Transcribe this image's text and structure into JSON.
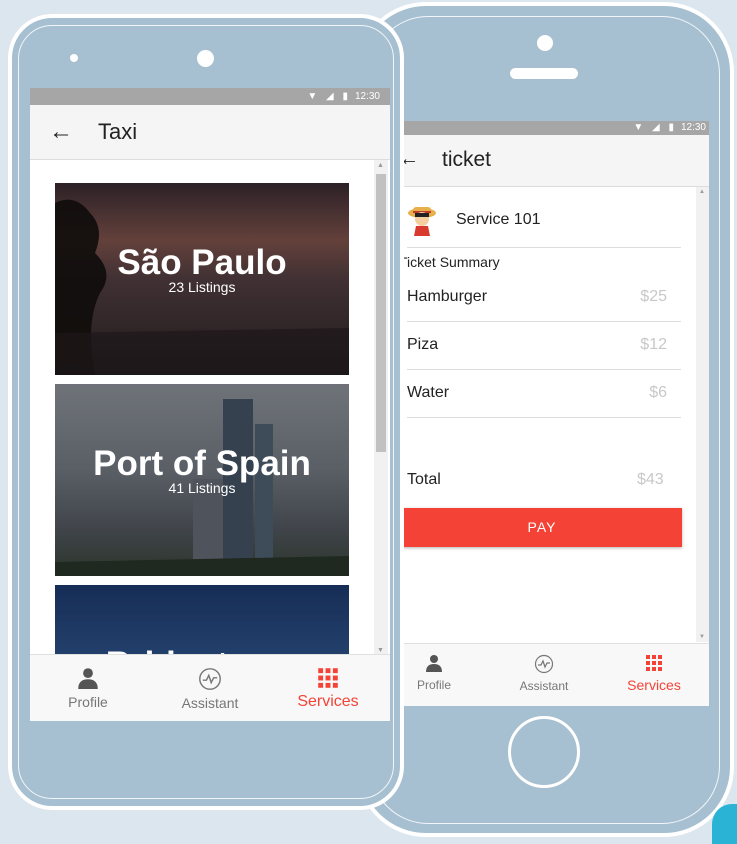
{
  "status_bar": {
    "icons": "▼ ◢ ▮",
    "time": "12:30"
  },
  "left_screen": {
    "title": "Taxi",
    "cards": [
      {
        "city": "São Paulo",
        "listings": "23 Listings"
      },
      {
        "city": "Port of Spain",
        "listings": "41 Listings"
      },
      {
        "city": "Bridgetown",
        "listings": ""
      }
    ]
  },
  "right_screen": {
    "title": "ticket",
    "service_name": "Service 101",
    "summary_label": "Ticket Summary",
    "items": [
      {
        "name": "Hamburger",
        "price": "$25"
      },
      {
        "name": "Piza",
        "price": "$12"
      },
      {
        "name": "Water",
        "price": "$6"
      }
    ],
    "total_label": "Total",
    "total_value": "$43",
    "pay_label": "PAY"
  },
  "nav": {
    "profile": "Profile",
    "assistant": "Assistant",
    "services": "Services"
  },
  "colors": {
    "accent": "#f44336",
    "phone_body": "#a6c0d1",
    "background": "#dce6ee"
  }
}
